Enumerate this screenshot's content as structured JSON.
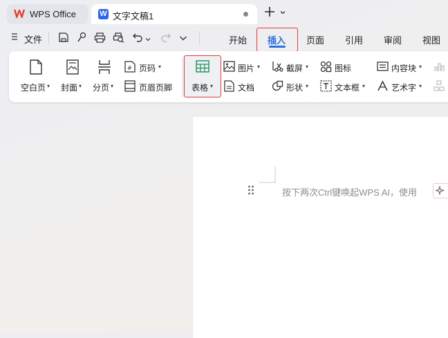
{
  "tabs": {
    "home_label": "WPS Office",
    "doc_label": "文字文稿1"
  },
  "menu": {
    "file": "文件",
    "tabs": [
      "开始",
      "插入",
      "页面",
      "引用",
      "审阅",
      "视图"
    ]
  },
  "ribbon": {
    "blank_page": "空白页",
    "cover": "封面",
    "page_break": "分页",
    "page_number": "页码",
    "header_footer": "页眉页脚",
    "table": "表格",
    "picture": "图片",
    "screenshot": "截屏",
    "icon": "图标",
    "content_block": "内容块",
    "document": "文档",
    "shape": "形状",
    "textbox": "文本框",
    "wordart": "艺术字"
  },
  "document": {
    "hint": "按下两次Ctrl键唤起WPS AI，使用"
  },
  "colors": {
    "accent_blue": "#2d6ee0",
    "highlight_red": "#e4393c",
    "wps_red": "#e8392c"
  }
}
